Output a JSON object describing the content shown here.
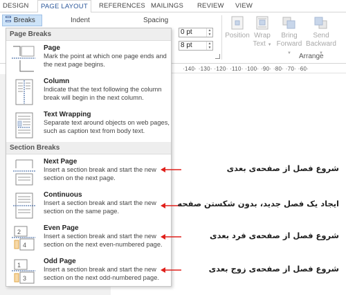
{
  "tabs": [
    {
      "label": "DESIGN",
      "active": false
    },
    {
      "label": "PAGE LAYOUT",
      "active": true
    },
    {
      "label": "REFERENCES",
      "active": false
    },
    {
      "label": "MAILINGS",
      "active": false
    },
    {
      "label": "REVIEW",
      "active": false
    },
    {
      "label": "VIEW",
      "active": false
    }
  ],
  "ribbon": {
    "breaks_label": "Breaks",
    "indent_label": "Indent",
    "spacing_label": "Spacing",
    "before_value": "0 pt",
    "after_value": "8 pt",
    "arrange_label": "Arrange",
    "arrange_buttons": [
      {
        "line1": "Position",
        "line2": ""
      },
      {
        "line1": "Wrap",
        "line2": "Text"
      },
      {
        "line1": "Bring",
        "line2": "Forward"
      },
      {
        "line1": "Send",
        "line2": "Backward"
      }
    ]
  },
  "ruler_text": "·140· ·130· ·120· ·110· ·100· ·90· ·80· ·70· ·60·",
  "menu": {
    "page_breaks_header": "Page Breaks",
    "section_breaks_header": "Section Breaks",
    "page_items": [
      {
        "title": "Page",
        "desc": "Mark the point at which one page ends and the next page begins."
      },
      {
        "title": "Column",
        "desc": "Indicate that the text following the column break will begin in the next column."
      },
      {
        "title": "Text Wrapping",
        "desc": "Separate text around objects on web pages, such as caption text from body text."
      }
    ],
    "section_items": [
      {
        "title": "Next Page",
        "desc": "Insert a section break and start the new section on the next page."
      },
      {
        "title": "Continuous",
        "desc": "Insert a section break and start the new section on the same page."
      },
      {
        "title": "Even Page",
        "desc": "Insert a section break and start the new section on the next even-numbered page."
      },
      {
        "title": "Odd Page",
        "desc": "Insert a section break and start the new section on the next odd-numbered page."
      }
    ]
  },
  "annotations": {
    "next_page": "شروع فصل از صفحه‌ی بعدی",
    "continuous": "ایجاد یک فصل جدید، بدون شکستن صفحه",
    "even_page": "شروع فصل از صفحه‌ی فرد بعدی",
    "odd_page": "شروع فصل از صفحه‌ی زوج بعدی"
  },
  "colors": {
    "accent": "#2b579a",
    "arrow_red": "#e0201b",
    "selected_button": "#cde3f8"
  }
}
